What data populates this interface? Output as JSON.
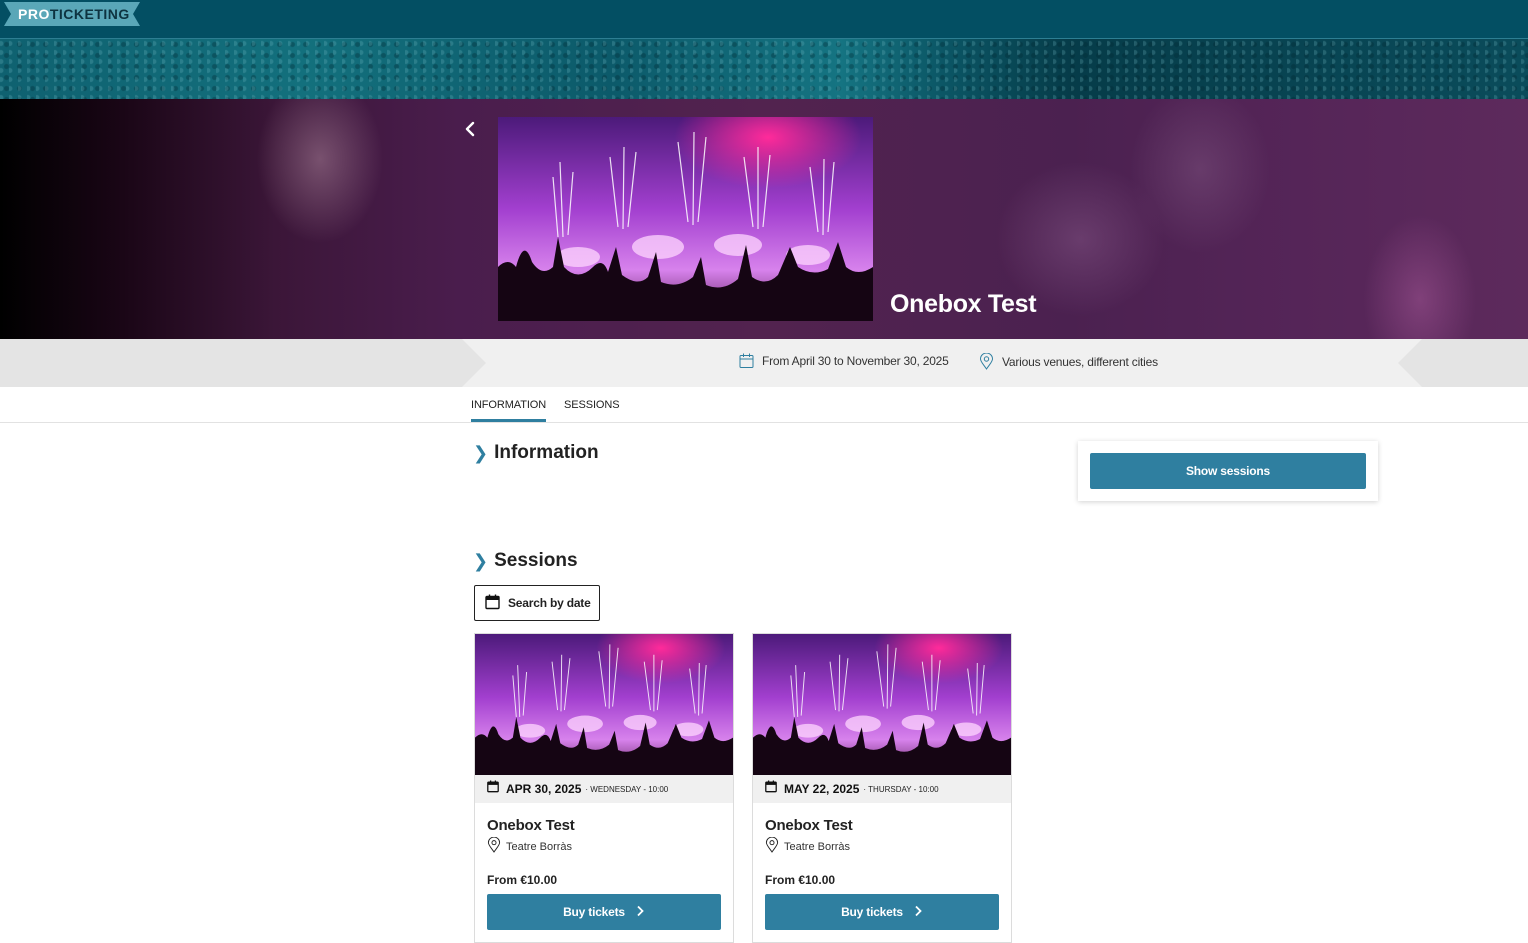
{
  "header": {
    "logo_pro": "PRO",
    "logo_ticketing": "TICKETING"
  },
  "event": {
    "title": "Onebox Test",
    "dates": "From April 30 to November 30, 2025",
    "venues": "Various venues, different cities"
  },
  "tabs": [
    {
      "label": "INFORMATION",
      "active": true
    },
    {
      "label": "SESSIONS",
      "active": false
    }
  ],
  "sections": {
    "information": "Information",
    "sessions": "Sessions"
  },
  "sidebar": {
    "show_sessions": "Show sessions"
  },
  "search": {
    "label": "Search by date"
  },
  "sessions": [
    {
      "date": "APR 30, 2025",
      "weekday_time": "· WEDNESDAY - 10:00",
      "title": "Onebox Test",
      "venue": "Teatre Borràs",
      "price": "From €10.00",
      "button": "Buy tickets"
    },
    {
      "date": "MAY 22, 2025",
      "weekday_time": "· THURSDAY - 10:00",
      "title": "Onebox Test",
      "venue": "Teatre Borràs",
      "price": "From €10.00",
      "button": "Buy tickets"
    }
  ],
  "colors": {
    "topbar": "#034f63",
    "accent": "#2f7fa0",
    "logo_bg": "#5aa7b8"
  },
  "icons": [
    "back-chevron-icon",
    "calendar-icon",
    "location-pin-icon",
    "chevron-right-icon"
  ]
}
